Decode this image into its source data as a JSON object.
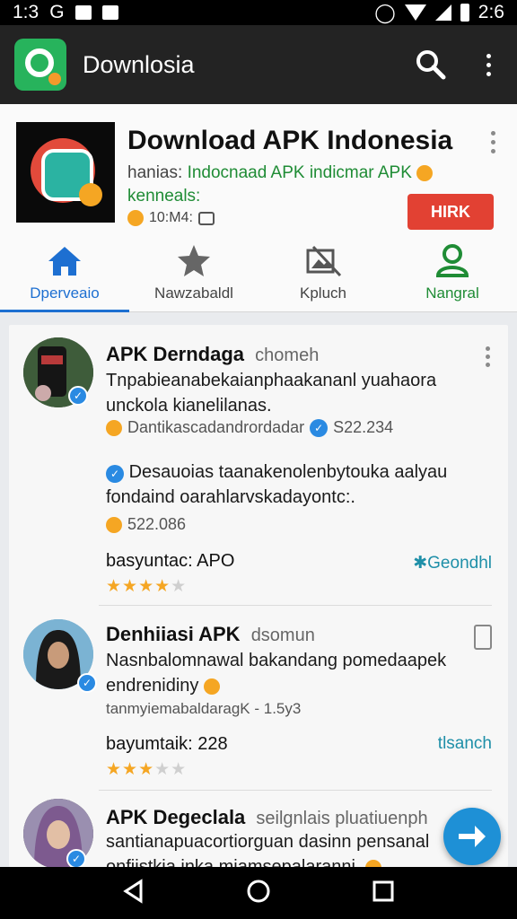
{
  "status_bar": {
    "time": "1:3",
    "carrier": "G",
    "battery_time": "2:6"
  },
  "app_bar": {
    "title": "Downlosia"
  },
  "hero": {
    "title": "Download APK Indonesia",
    "line1_label": "hanias:",
    "line1_value": "Indocnaad APK indicmar APK",
    "line2": "kenneals:",
    "meta": "10:M4:",
    "button": "HIRK"
  },
  "tabs": [
    {
      "label": "Dperveaio",
      "icon": "home-icon"
    },
    {
      "label": "Nawzabaldl",
      "icon": "star-icon"
    },
    {
      "label": "Kpluch",
      "icon": "gallery-icon"
    },
    {
      "label": "Nangral",
      "icon": "person-icon"
    }
  ],
  "posts": [
    {
      "title": "APK Derndaga",
      "subtitle": "chomeh",
      "text": "Tnpabieanabekaianphaakananl yuahaora unckola kianelilanas.",
      "meta_name": "Dantikascadandrordadar",
      "meta_count": "S22.234",
      "text2": "Desauoias taanakenolenbytouka aalyau fondaind oarahlarvskadayontc:.",
      "count2": "522.086",
      "footer_label": "basyuntac: APO",
      "rating": 4,
      "action": "Geondhl"
    },
    {
      "title": "Denhiiasi APK",
      "subtitle": "dsomun",
      "text": "Nasnbalomnawal bakandang pomedaapek endrenidiny",
      "meta_name": "tanmyiemabaldaragK - 1.5y3",
      "footer_label": "bayumtaik: 228",
      "rating": 3,
      "action": "tlsanch"
    },
    {
      "title": "APK Degeclala",
      "subtitle": "seilgnlais pluatiuenph",
      "text": "santianapuacortiorguan dasinn pensanal onfiistkia inka miamsepalarannj."
    }
  ],
  "colors": {
    "accent": "#1d6fd1",
    "green": "#1f8c35",
    "cta": "#e24133",
    "fab": "#1e90d6"
  }
}
